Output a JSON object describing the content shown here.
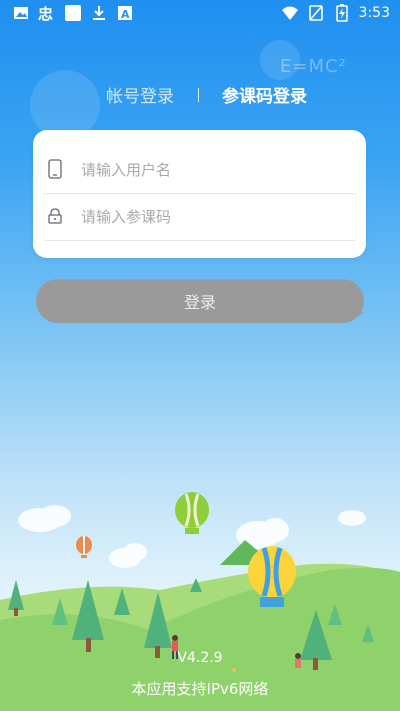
{
  "status_bar": {
    "time": "3:53",
    "left_icons": [
      "image-icon",
      "app-logo-icon",
      "square-icon",
      "download-icon",
      "text-icon"
    ],
    "right_icons": [
      "wifi-icon",
      "no-sim-icon",
      "battery-charging-icon"
    ]
  },
  "tabs": {
    "account": "帐号登录",
    "code": "参课码登录",
    "active": "code"
  },
  "form": {
    "username_placeholder": "请输入用户名",
    "code_placeholder": "请输入参课码",
    "username_value": "",
    "code_value": ""
  },
  "login_button": "登录",
  "decor": {
    "formula": "E=MC²"
  },
  "footer": {
    "version": "V4.2.9",
    "ipv6": "本应用支持IPv6网络"
  },
  "colors": {
    "bg_top": "#1f8ff0",
    "button": "#9a9a9a",
    "hill": "#8fd16a",
    "tree": "#4fb27a"
  }
}
